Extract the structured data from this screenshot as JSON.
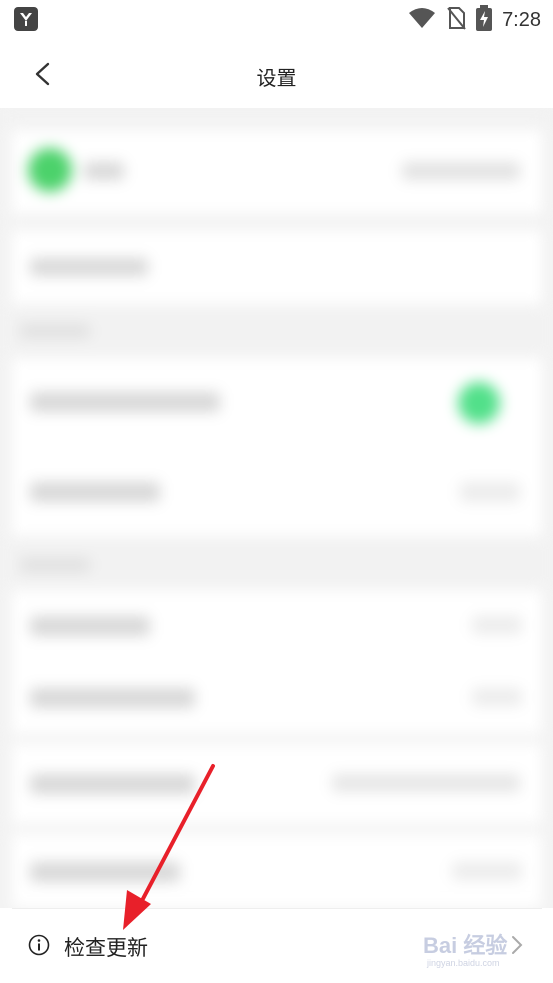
{
  "status_bar": {
    "time": "7:28",
    "icons": [
      "wifi-icon",
      "no-sim-icon",
      "battery-charging-icon"
    ]
  },
  "header": {
    "title": "设置",
    "back_icon": "chevron-left-icon"
  },
  "settings": {
    "check_update_label": "检查更新",
    "check_update_icon": "info-icon",
    "chevron_icon": "chevron-right-icon"
  },
  "watermark": {
    "logo_text": "Bai 经验",
    "url": "jingyan.baidu.com"
  },
  "annotation": {
    "arrow_color": "#e8202a"
  },
  "colors": {
    "accent_green": "#4cd26b"
  }
}
